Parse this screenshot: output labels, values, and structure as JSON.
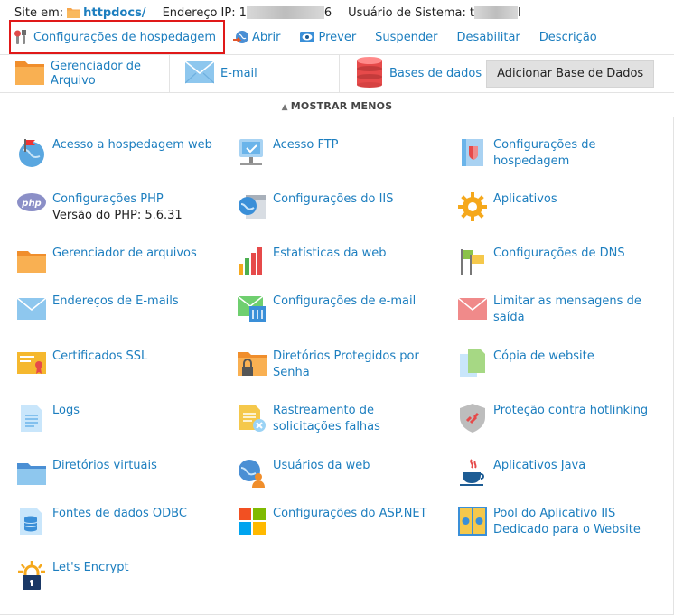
{
  "info": {
    "site_label": "Site em:",
    "domain": "httpdocs/",
    "ip_label": "Endereço IP:",
    "ip_value_start": "1",
    "ip_value_end": "6",
    "user_label": "Usuário de Sistema:",
    "user_value_start": "t",
    "user_value_end": "l"
  },
  "actions": [
    {
      "label": "Configurações de hospedagem",
      "icon": "wrench-tools-icon"
    },
    {
      "label": "Abrir",
      "icon": "globe-arrow-icon"
    },
    {
      "label": "Prever",
      "icon": "eye-preview-icon"
    },
    {
      "label": "Suspender",
      "icon": ""
    },
    {
      "label": "Desabilitar",
      "icon": ""
    },
    {
      "label": "Descrição",
      "icon": ""
    }
  ],
  "toolbar": {
    "file_manager": "Gerenciador de Arquivo",
    "email": "E-mail",
    "databases": "Bases de dados",
    "add_db_button": "Adicionar Base de Dados"
  },
  "show_less": "MOSTRAR MENOS",
  "grid": {
    "items": [
      {
        "label": "Acesso a hospedagem web",
        "icon": "globe-flag-icon"
      },
      {
        "label": "Acesso FTP",
        "icon": "ftp-monitor-icon"
      },
      {
        "label": "Configurações de hospedagem",
        "icon": "hosting-book-icon"
      },
      {
        "label": "Configurações PHP",
        "sub": "Versão do PHP: 5.6.31",
        "icon": "php-icon"
      },
      {
        "label": "Configurações do IIS",
        "icon": "iis-icon"
      },
      {
        "label": "Aplicativos",
        "icon": "gear-icon"
      },
      {
        "label": "Gerenciador de arquivos",
        "icon": "folder-icon"
      },
      {
        "label": "Estatísticas da web",
        "icon": "bar-chart-icon"
      },
      {
        "label": "Configurações de DNS",
        "icon": "dns-flags-icon"
      },
      {
        "label": "Endereços de E-mails",
        "icon": "envelope-icon"
      },
      {
        "label": "Configurações de e-mail",
        "icon": "envelope-settings-icon"
      },
      {
        "label": "Limitar as mensagens de saída",
        "icon": "envelope-limit-icon"
      },
      {
        "label": "Certificados SSL",
        "icon": "certificate-icon"
      },
      {
        "label": "Diretórios Protegidos por Senha",
        "icon": "folder-lock-icon"
      },
      {
        "label": "Cópia de website",
        "icon": "copy-pages-icon"
      },
      {
        "label": "Logs",
        "icon": "log-file-icon"
      },
      {
        "label": "Rastreamento de solicitações falhas",
        "icon": "failed-request-icon"
      },
      {
        "label": "Proteção contra hotlinking",
        "icon": "shield-link-icon"
      },
      {
        "label": "Diretórios virtuais",
        "icon": "virtual-folder-icon"
      },
      {
        "label": "Usuários da web",
        "icon": "web-users-icon"
      },
      {
        "label": "Aplicativos Java",
        "icon": "java-cup-icon"
      },
      {
        "label": "Fontes de dados ODBC",
        "icon": "database-page-icon"
      },
      {
        "label": "Configurações do ASP.NET",
        "icon": "windows-logo-icon"
      },
      {
        "label": "Pool do Aplicativo IIS Dedicado para o Website",
        "icon": "app-pool-icon"
      },
      {
        "label": "Let's Encrypt",
        "icon": "lets-encrypt-lock-icon"
      }
    ]
  },
  "colors": {
    "link": "#1c7ebf",
    "highlight_border": "#e01919",
    "button_bg": "#e1e1e1"
  }
}
